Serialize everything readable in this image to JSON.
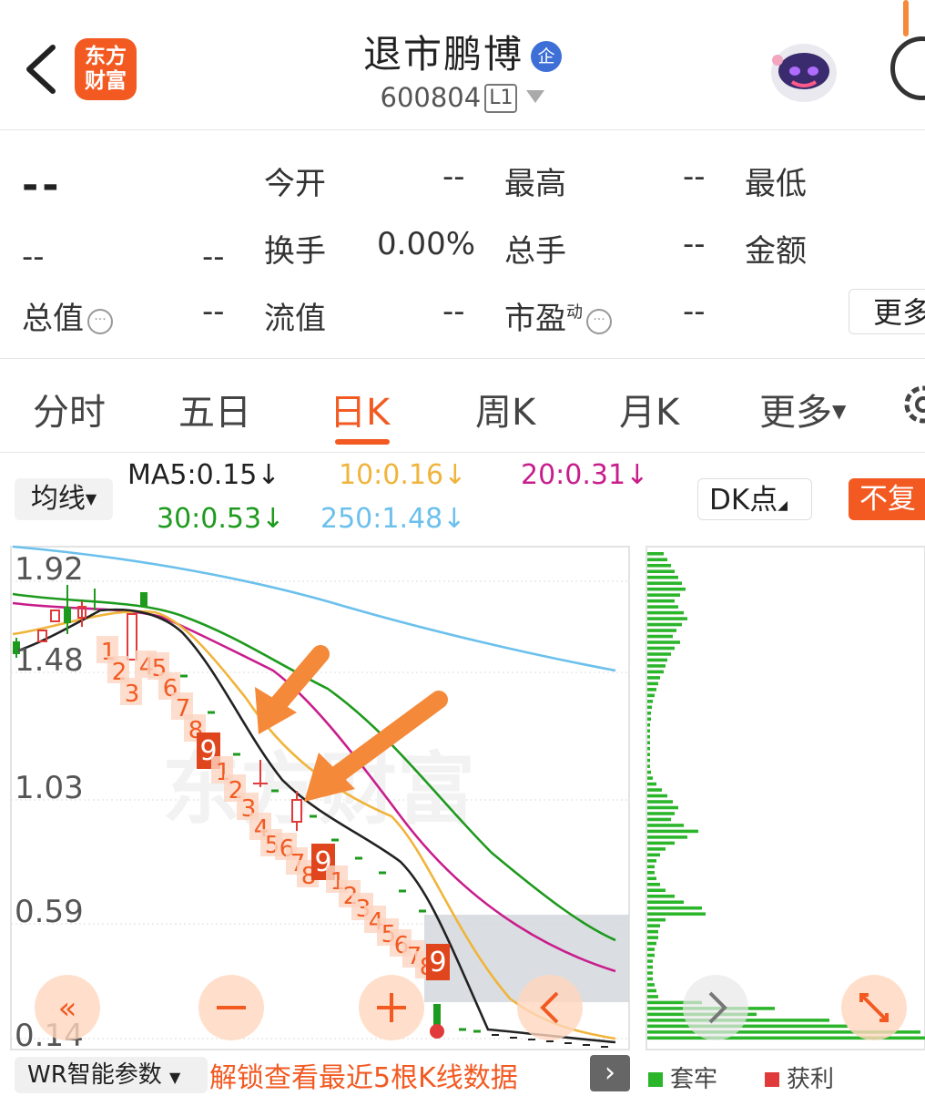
{
  "header": {
    "back_icon": "chevron-left-icon",
    "logo_line1": "东方",
    "logo_line2": "财富",
    "stock_name": "退市鹏博",
    "badge": "企",
    "stock_code": "600804",
    "level": "L1",
    "colors": {
      "brand": "#f25a22",
      "badge": "#3d6fd6"
    }
  },
  "quote": {
    "price": "--",
    "change": "--",
    "change_pct": "--",
    "open_label": "今开",
    "open_value": "--",
    "high_label": "最高",
    "high_value": "--",
    "low_label": "最低",
    "turnover_label": "换手",
    "turnover_value": "0.00%",
    "volume_label": "总手",
    "volume_value": "--",
    "amount_label": "金额",
    "mktcap_label": "总值",
    "mktcap_value": "--",
    "float_label": "流值",
    "float_value": "--",
    "pe_label": "市盈",
    "pe_sup": "动",
    "pe_value": "--",
    "more_label": "更多"
  },
  "tabs": [
    {
      "label": "分时"
    },
    {
      "label": "五日"
    },
    {
      "label": "日K",
      "active": true
    },
    {
      "label": "周K"
    },
    {
      "label": "月K"
    },
    {
      "label": "更多"
    }
  ],
  "indicators": {
    "ma_button": "均线",
    "ma5": "MA5:0.15",
    "ma10": "10:0.16",
    "ma20": "20:0.31",
    "ma30": "30:0.53",
    "ma250": "250:1.48",
    "down_arrow": "↓",
    "dk_button": "DK点",
    "fq_button": "不复",
    "colors": {
      "ma5": "#222222",
      "ma10": "#f0b43c",
      "ma20": "#c81e8c",
      "ma30": "#1e9a1e",
      "ma250": "#6bc0ec"
    }
  },
  "chart": {
    "price_labels": [
      "1.92",
      "1.48",
      "1.03",
      "0.59",
      "0.14"
    ],
    "watermark": "东方财富",
    "td_numbers": [
      "1",
      "2",
      "3",
      "4",
      "5",
      "6",
      "7",
      "8",
      "9",
      "1",
      "2",
      "3",
      "4",
      "5",
      "6",
      "7",
      "8",
      "9",
      "1",
      "2",
      "3",
      "4",
      "5",
      "6",
      "7",
      "8",
      "9"
    ],
    "controls": [
      "double-left-icon",
      "zoom-out-icon",
      "zoom-in-icon",
      "left-icon",
      "right-icon",
      "expand-icon"
    ]
  },
  "bottom": {
    "wr_button": "WR智能参数",
    "unlock_text": "解锁查看最近5根K线数据",
    "legend_trapped": "套牢",
    "legend_profit": "获利",
    "colors": {
      "trapped": "#2bb52b",
      "profit": "#e03a3a"
    }
  }
}
